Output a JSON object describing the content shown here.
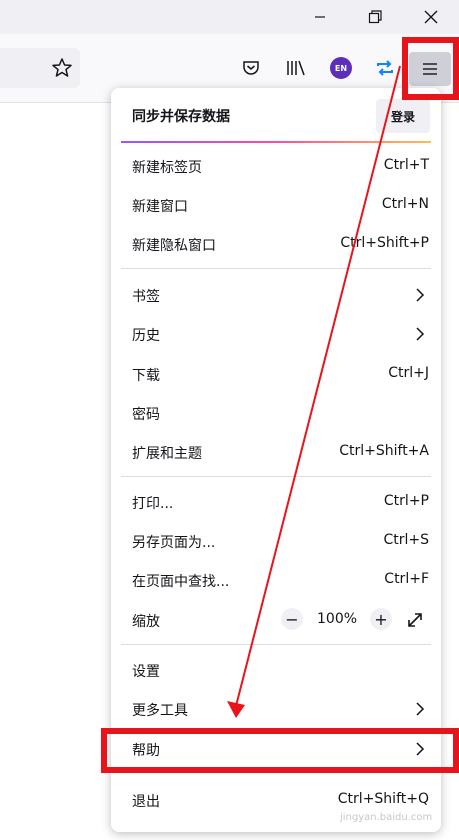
{
  "window": {
    "minimize_icon": "minimize-icon",
    "restore_icon": "restore-icon",
    "close_icon": "close-icon"
  },
  "toolbar": {
    "bookmark_icon": "star-icon",
    "pocket_icon": "pocket-icon",
    "library_icon": "library-icon",
    "language_badge": "EN",
    "sync_icon": "sync-icon",
    "menu_icon": "hamburger-menu-icon"
  },
  "menu": {
    "sync_title": "同步并保存数据",
    "login_label": "登录",
    "items": [
      {
        "label": "新建标签页",
        "shortcut": "Ctrl+T"
      },
      {
        "label": "新建窗口",
        "shortcut": "Ctrl+N"
      },
      {
        "label": "新建隐私窗口",
        "shortcut": "Ctrl+Shift+P"
      },
      {
        "label": "书签"
      },
      {
        "label": "历史"
      },
      {
        "label": "下载",
        "shortcut": "Ctrl+J"
      },
      {
        "label": "密码"
      },
      {
        "label": "扩展和主题",
        "shortcut": "Ctrl+Shift+A"
      },
      {
        "label": "打印...",
        "shortcut": "Ctrl+P"
      },
      {
        "label": "另存页面为...",
        "shortcut": "Ctrl+S"
      },
      {
        "label": "在页面中查找...",
        "shortcut": "Ctrl+F"
      },
      {
        "label": "缩放"
      },
      {
        "label": "设置"
      },
      {
        "label": "更多工具"
      },
      {
        "label": "帮助"
      },
      {
        "label": "退出",
        "shortcut": "Ctrl+Shift+Q"
      }
    ],
    "zoom": {
      "minus": "−",
      "value": "100%",
      "plus": "+"
    }
  },
  "annotation": {
    "color": "#e8141b"
  },
  "watermark": "jingyan.baidu.com"
}
